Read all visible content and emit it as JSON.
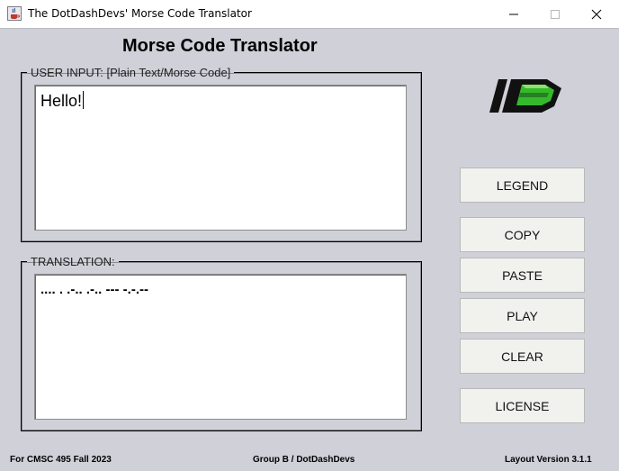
{
  "window": {
    "title": "The DotDashDevs' Morse Code Translator",
    "icon": "java-cup-icon",
    "controls": [
      "minimize-icon",
      "maximize-icon",
      "close-icon"
    ]
  },
  "header": {
    "title": "Morse Code Translator"
  },
  "input_panel": {
    "legend": "USER INPUT: [Plain Text/Morse Code]",
    "value": "Hello!"
  },
  "output_panel": {
    "legend": "TRANSLATION:",
    "value": ".... . .-.. .-.. --- -.-.--"
  },
  "logo": {
    "text": ".ID",
    "colors": {
      "dark": "#111111",
      "green": "#35b92c",
      "light_green": "#8fe06a"
    }
  },
  "buttons": {
    "legend": "LEGEND",
    "copy": "COPY",
    "paste": "PASTE",
    "play": "PLAY",
    "clear": "CLEAR",
    "license": "LICENSE"
  },
  "footer": {
    "left": "For CMSC 495 Fall 2023",
    "center": "Group B / DotDashDevs",
    "right": "Layout Version 3.1.1"
  },
  "colors": {
    "background": "#cfd0d8",
    "button_face": "#f1f1ee",
    "titlebar": "#ffffff"
  }
}
